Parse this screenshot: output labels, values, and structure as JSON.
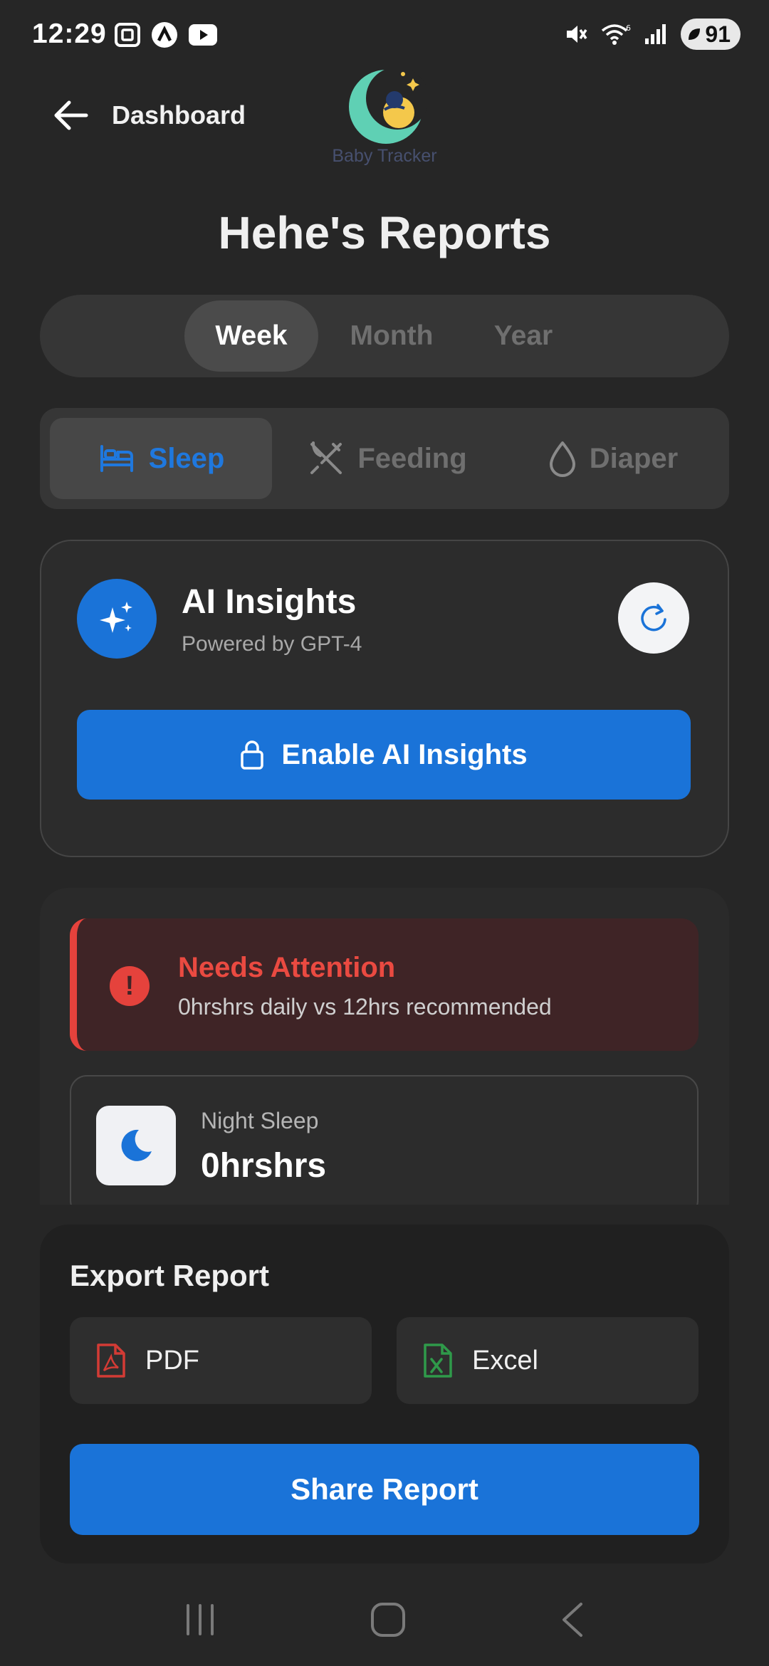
{
  "status_bar": {
    "time": "12:29",
    "battery": "91"
  },
  "header": {
    "back_label": "Dashboard",
    "logo_text": "Baby Tracker",
    "title": "Hehe's Reports"
  },
  "period_tabs": [
    {
      "label": "Week",
      "active": true
    },
    {
      "label": "Month",
      "active": false
    },
    {
      "label": "Year",
      "active": false
    }
  ],
  "category_tabs": [
    {
      "label": "Sleep",
      "icon": "bed-icon",
      "active": true
    },
    {
      "label": "Feeding",
      "icon": "utensils-icon",
      "active": false
    },
    {
      "label": "Diaper",
      "icon": "droplet-icon",
      "active": false
    }
  ],
  "ai_insights": {
    "title": "AI Insights",
    "subtitle": "Powered by GPT-4",
    "enable_label": "Enable AI Insights"
  },
  "alert": {
    "title": "Needs Attention",
    "description": "0hrshrs daily vs 12hrs recommended"
  },
  "stat": {
    "label": "Night Sleep",
    "value": "0hrshrs"
  },
  "export": {
    "title": "Export Report",
    "pdf_label": "PDF",
    "excel_label": "Excel",
    "share_label": "Share Report"
  },
  "colors": {
    "accent": "#1a73d8",
    "alert": "#e5423c",
    "background": "#262626"
  }
}
